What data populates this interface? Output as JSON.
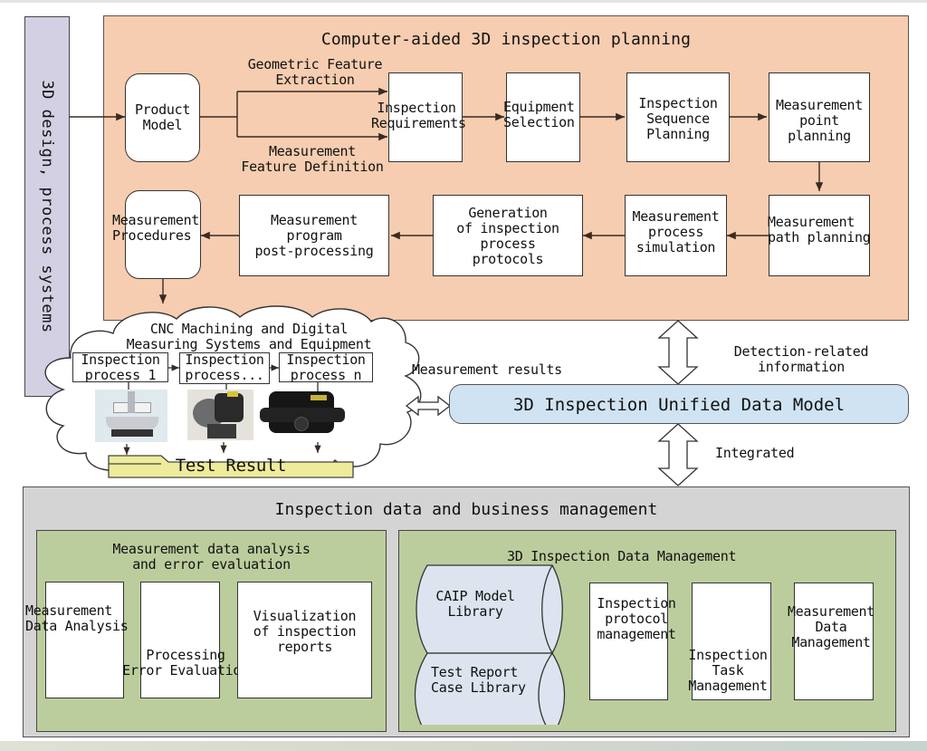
{
  "left_system": {
    "label": "3D design, process systems"
  },
  "planning": {
    "title": "Computer-aided 3D inspection planning",
    "nodes": {
      "product_model": "Product\nModel",
      "geometric_feature": "Geometric Feature\nExtraction",
      "measurement_feature": "Measurement\nFeature Definition",
      "inspection_requirements": "Inspection\nRequirements",
      "equipment_selection": "Equipment\nSelection",
      "inspection_sequence": "Inspection\nSequence\nPlanning",
      "measurement_point": "Measurement\npoint\nplanning",
      "measurement_path": "Measurement\npath planning",
      "process_simulation": "Measurement\nprocess\nsimulation",
      "protocol_generation": "Generation\nof inspection\nprocess\nprotocols",
      "post_processing": "Measurement\nprogram\npost-processing",
      "procedures": "Measurement\nProcedures"
    }
  },
  "cnc": {
    "title": "CNC Machining and Digital\nMeasuring Systems and Equipment",
    "processes": [
      "Inspection\nprocess 1",
      "Inspection\nprocess...",
      "Inspection\nprocess n"
    ],
    "devices": [
      "coordinate-measuring-machine-image",
      "laser-tracker-image",
      "portable-scanner-image"
    ],
    "test_result": "Test Result"
  },
  "links": {
    "measurement_results": "Measurement results",
    "detection_info": "Detection-related\ninformation",
    "integrated": "Integrated"
  },
  "data_model": {
    "label": "3D Inspection Unified Data Model"
  },
  "management": {
    "title": "Inspection data and business management",
    "analysis": {
      "title": "Measurement data analysis\nand error evaluation",
      "items": [
        "Measurement\nData Analysis",
        "Processing\nError Evaluation",
        "Visualization\nof inspection\nreports"
      ]
    },
    "data_mgmt": {
      "title": "3D Inspection Data Management",
      "libraries": [
        "CAIP Model\nLibrary",
        "Test Report\nCase Library"
      ],
      "items": [
        "Inspection\nprotocol\nmanagement",
        "Inspection\nTask\nManagement",
        "Measurement\nData\nManagement"
      ]
    }
  },
  "colors": {
    "planning_bg": "#f6cdb0",
    "left_system_bg": "#d3d0e3",
    "data_model_bg": "#cfe3f3",
    "management_bg": "#d4d4d4",
    "subpanel_bg": "#bccd9d",
    "test_result_bg": "#eeec9a"
  }
}
